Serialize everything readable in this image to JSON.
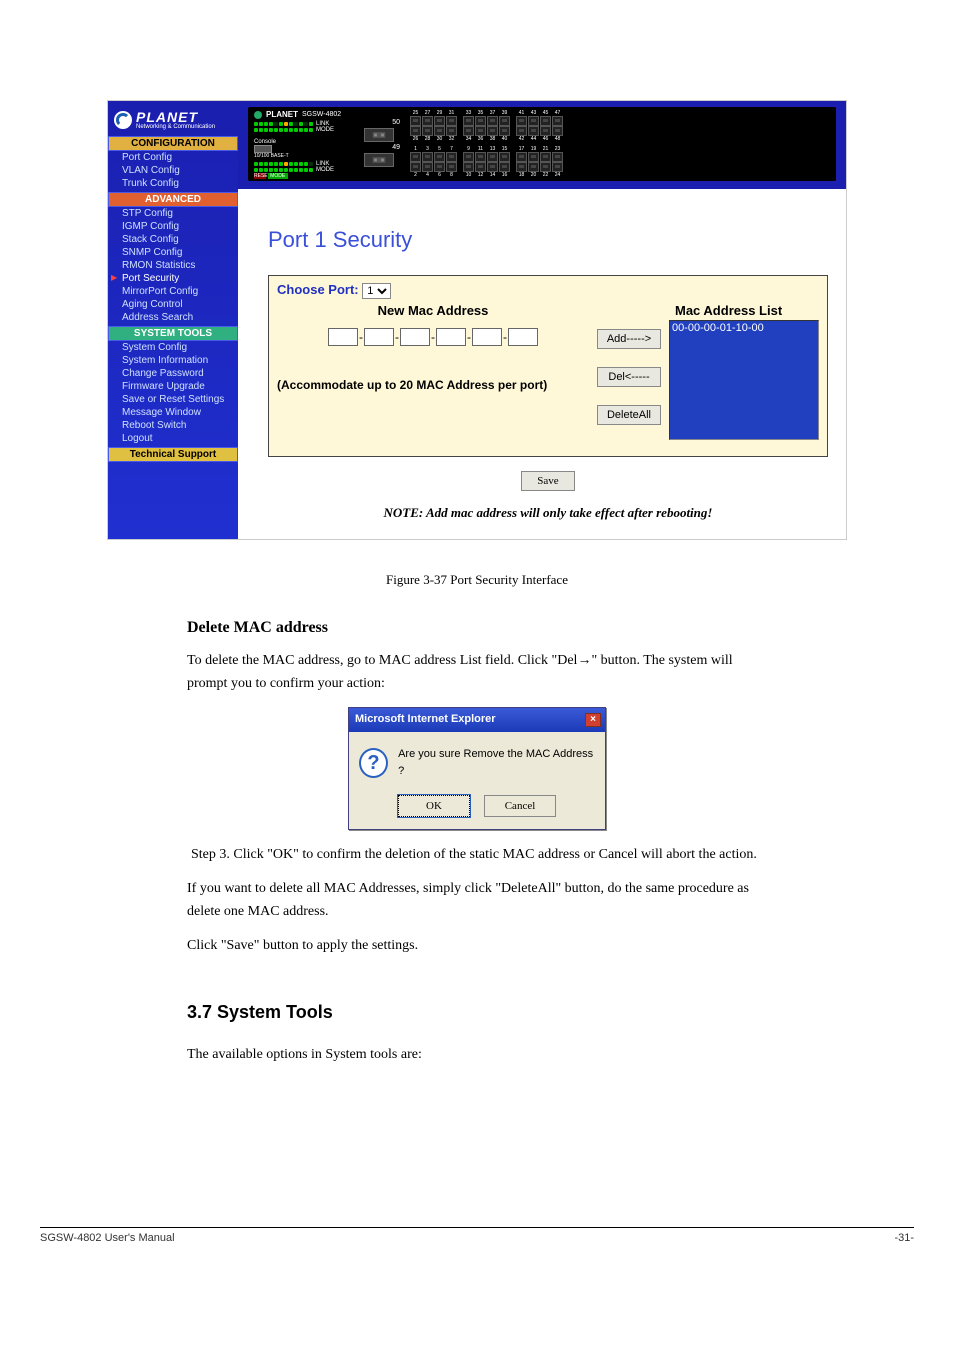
{
  "logo": {
    "brand": "PLANET",
    "tagline": "Networking & Communication"
  },
  "nav": {
    "sections": [
      {
        "header": "CONFIGURATION",
        "cls": "hdr-configuration",
        "items": [
          "Port Config",
          "VLAN Config",
          "Trunk Config"
        ]
      },
      {
        "header": "ADVANCED",
        "cls": "hdr-advanced",
        "items": [
          "STP Config",
          "IGMP Config",
          "Stack Config",
          "SNMP Config",
          "RMON Statistics",
          "Port Security",
          "MirrorPort Config",
          "Aging Control",
          "Address Search"
        ],
        "active": "Port Security"
      },
      {
        "header": "SYSTEM TOOLS",
        "cls": "hdr-systemtools",
        "items": [
          "System Config",
          "System Information",
          "Change Password",
          "Firmware Upgrade",
          "Save or Reset Settings",
          "Message Window",
          "Reboot Switch",
          "Logout"
        ]
      },
      {
        "header": "Technical Support",
        "cls": "hdr-techsupport",
        "items": []
      }
    ]
  },
  "device": {
    "brand": "PLANET",
    "model": "SGSW-4802",
    "led_labels": [
      "LINK",
      "MODE",
      "LINK",
      "MODE"
    ],
    "module_nums": [
      "50",
      "49"
    ],
    "port_top": [
      "25",
      "27",
      "29",
      "31",
      "",
      "33",
      "35",
      "37",
      "39",
      "",
      "41",
      "43",
      "45",
      "47"
    ],
    "port_bot": [
      "26",
      "28",
      "30",
      "32",
      "",
      "34",
      "36",
      "38",
      "40",
      "",
      "42",
      "44",
      "46",
      "48"
    ],
    "port_top2": [
      "1",
      "3",
      "5",
      "7",
      "",
      "9",
      "11",
      "13",
      "15",
      "",
      "17",
      "19",
      "21",
      "23"
    ],
    "port_bot2": [
      "2",
      "4",
      "6",
      "8",
      "",
      "10",
      "12",
      "14",
      "16",
      "",
      "18",
      "20",
      "22",
      "24"
    ],
    "console": "Console",
    "reset": "RESET",
    "mode_btn": "MODE",
    "bps": "10/100 BASE-T"
  },
  "page": {
    "title": "Port 1 Security",
    "choose_label": "Choose Port:",
    "choose_value": "1",
    "new_mac_heading": "New Mac Address",
    "mac_list_heading": "Mac Address List",
    "mac_list_item": "00-00-00-01-10-00",
    "accom": "(Accommodate up to 20 MAC Address per port)",
    "btn_add": "Add----->",
    "btn_del": "Del<-----",
    "btn_delall": "DeleteAll",
    "btn_save": "Save",
    "note": "NOTE: Add mac address will only take effect after rebooting!"
  },
  "fig_caption": "Figure 3-37 Port Security Interface",
  "delete_heading": "Delete MAC address",
  "delete_p1": "To delete the MAC address, go to MAC address List field. Click \"Del→\" button. The system will prompt you to confirm your action:",
  "ie_dialog": {
    "title": "Microsoft Internet Explorer",
    "msg": "Are you sure Remove the MAC Address ?",
    "ok": "OK",
    "cancel": "Cancel"
  },
  "step3": "Step 3. Click \"OK\" to confirm the deletion of the static MAC address or Cancel will abort the action.",
  "delete_all_p": "If you want to delete all MAC Addresses, simply click \"DeleteAll\" button, do the same procedure as delete one MAC address.",
  "savesave_p": "Click \"Save\" button to apply the settings.",
  "systools_heading": "3.7 System Tools",
  "systools_p": "The available options in System tools are:",
  "footer_left": "SGSW-4802 User's Manual",
  "footer_right": "-31-"
}
